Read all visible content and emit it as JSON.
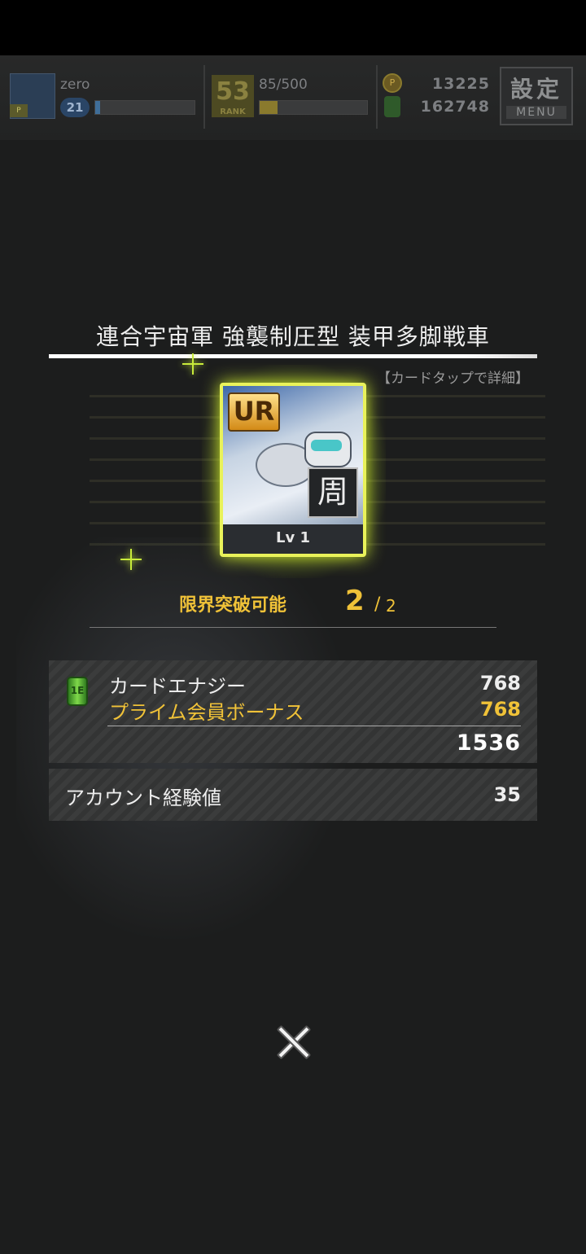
{
  "header": {
    "username": "zero",
    "player_level": "21",
    "rank": "53",
    "rank_label": "RANK",
    "stamina": "85/500",
    "coins": "13225",
    "energy": "162748",
    "menu_kanji": "設定",
    "menu_label": "MENU",
    "exp_progress": 0.05,
    "stamina_progress": 0.17
  },
  "card": {
    "name": "連合宇宙軍 強襲制圧型 装甲多脚戦車",
    "hint": "【カードタップで詳細】",
    "rarity": "UR",
    "type_badge": "周",
    "level": "Lv 1"
  },
  "limit_break": {
    "label": "限界突破可能",
    "current": "2",
    "separator": "/",
    "max": "2"
  },
  "rewards": {
    "energy_icon_text": "1E",
    "card_energy_label": "カードエナジー",
    "card_energy_value": "768",
    "prime_bonus_label": "プライム会員ボーナス",
    "prime_bonus_value": "768",
    "total_value": "1536",
    "account_exp_label": "アカウント経験値",
    "account_exp_value": "35"
  },
  "colors": {
    "accent_gold": "#f0c238",
    "card_glow": "#d7f530"
  },
  "icons": {
    "close": "close-icon",
    "energy": "energy-can-icon",
    "coin": "coin-icon"
  }
}
